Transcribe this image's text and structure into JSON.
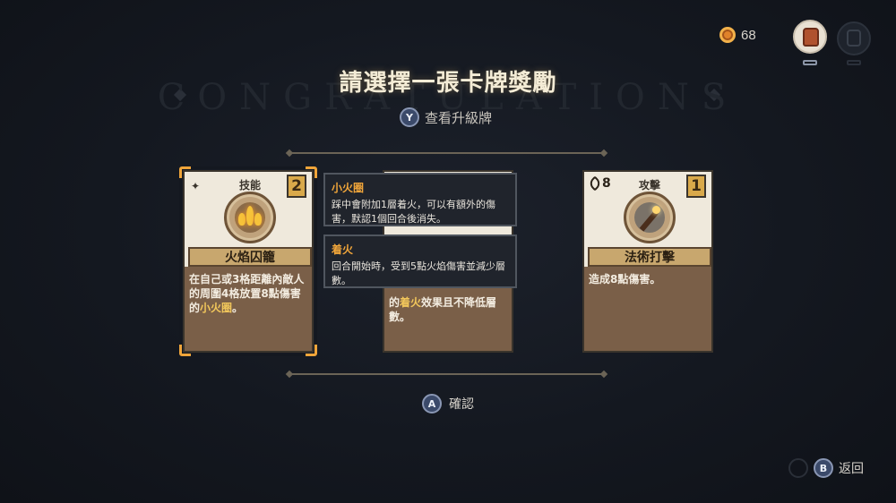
{
  "hud": {
    "coins": "68",
    "coin_icon": "coin-icon",
    "inventory_icon": "backpack-icon"
  },
  "background_text": "CONGRATULATIONS",
  "title": "請選擇一張卡牌獎勵",
  "view_upgrade": {
    "button": "Y",
    "label": "查看升級牌"
  },
  "cards": [
    {
      "type": "技能",
      "cost": "2",
      "name": "火焰囚籠",
      "desc_pre": "在自己或3格距離內敵人的周圍4格放置8點傷害的",
      "desc_hl": "小火圈",
      "desc_post": "。",
      "selected": true,
      "icon": "flame-cage-icon"
    },
    {
      "desc_hl_pre": "的",
      "desc_hl": "着火",
      "desc_post": "效果且不降低層數。"
    },
    {
      "type": "攻擊",
      "cost": "1",
      "damage": "8",
      "name": "法術打擊",
      "desc": "造成8點傷害。",
      "icon": "magic-staff-icon"
    }
  ],
  "tooltips": [
    {
      "title": "小火圈",
      "body": "踩中會附加1層着火，可以有額外的傷害，默認1個回合後消失。"
    },
    {
      "title": "着火",
      "body": "回合開始時，受到5點火焰傷害並減少層數。"
    }
  ],
  "confirm": {
    "button": "A",
    "label": "確認"
  },
  "back": {
    "button": "B",
    "label": "返回"
  },
  "colors": {
    "accent": "#f0a53a",
    "highlight": "#f2c75b",
    "background": "#141820"
  }
}
